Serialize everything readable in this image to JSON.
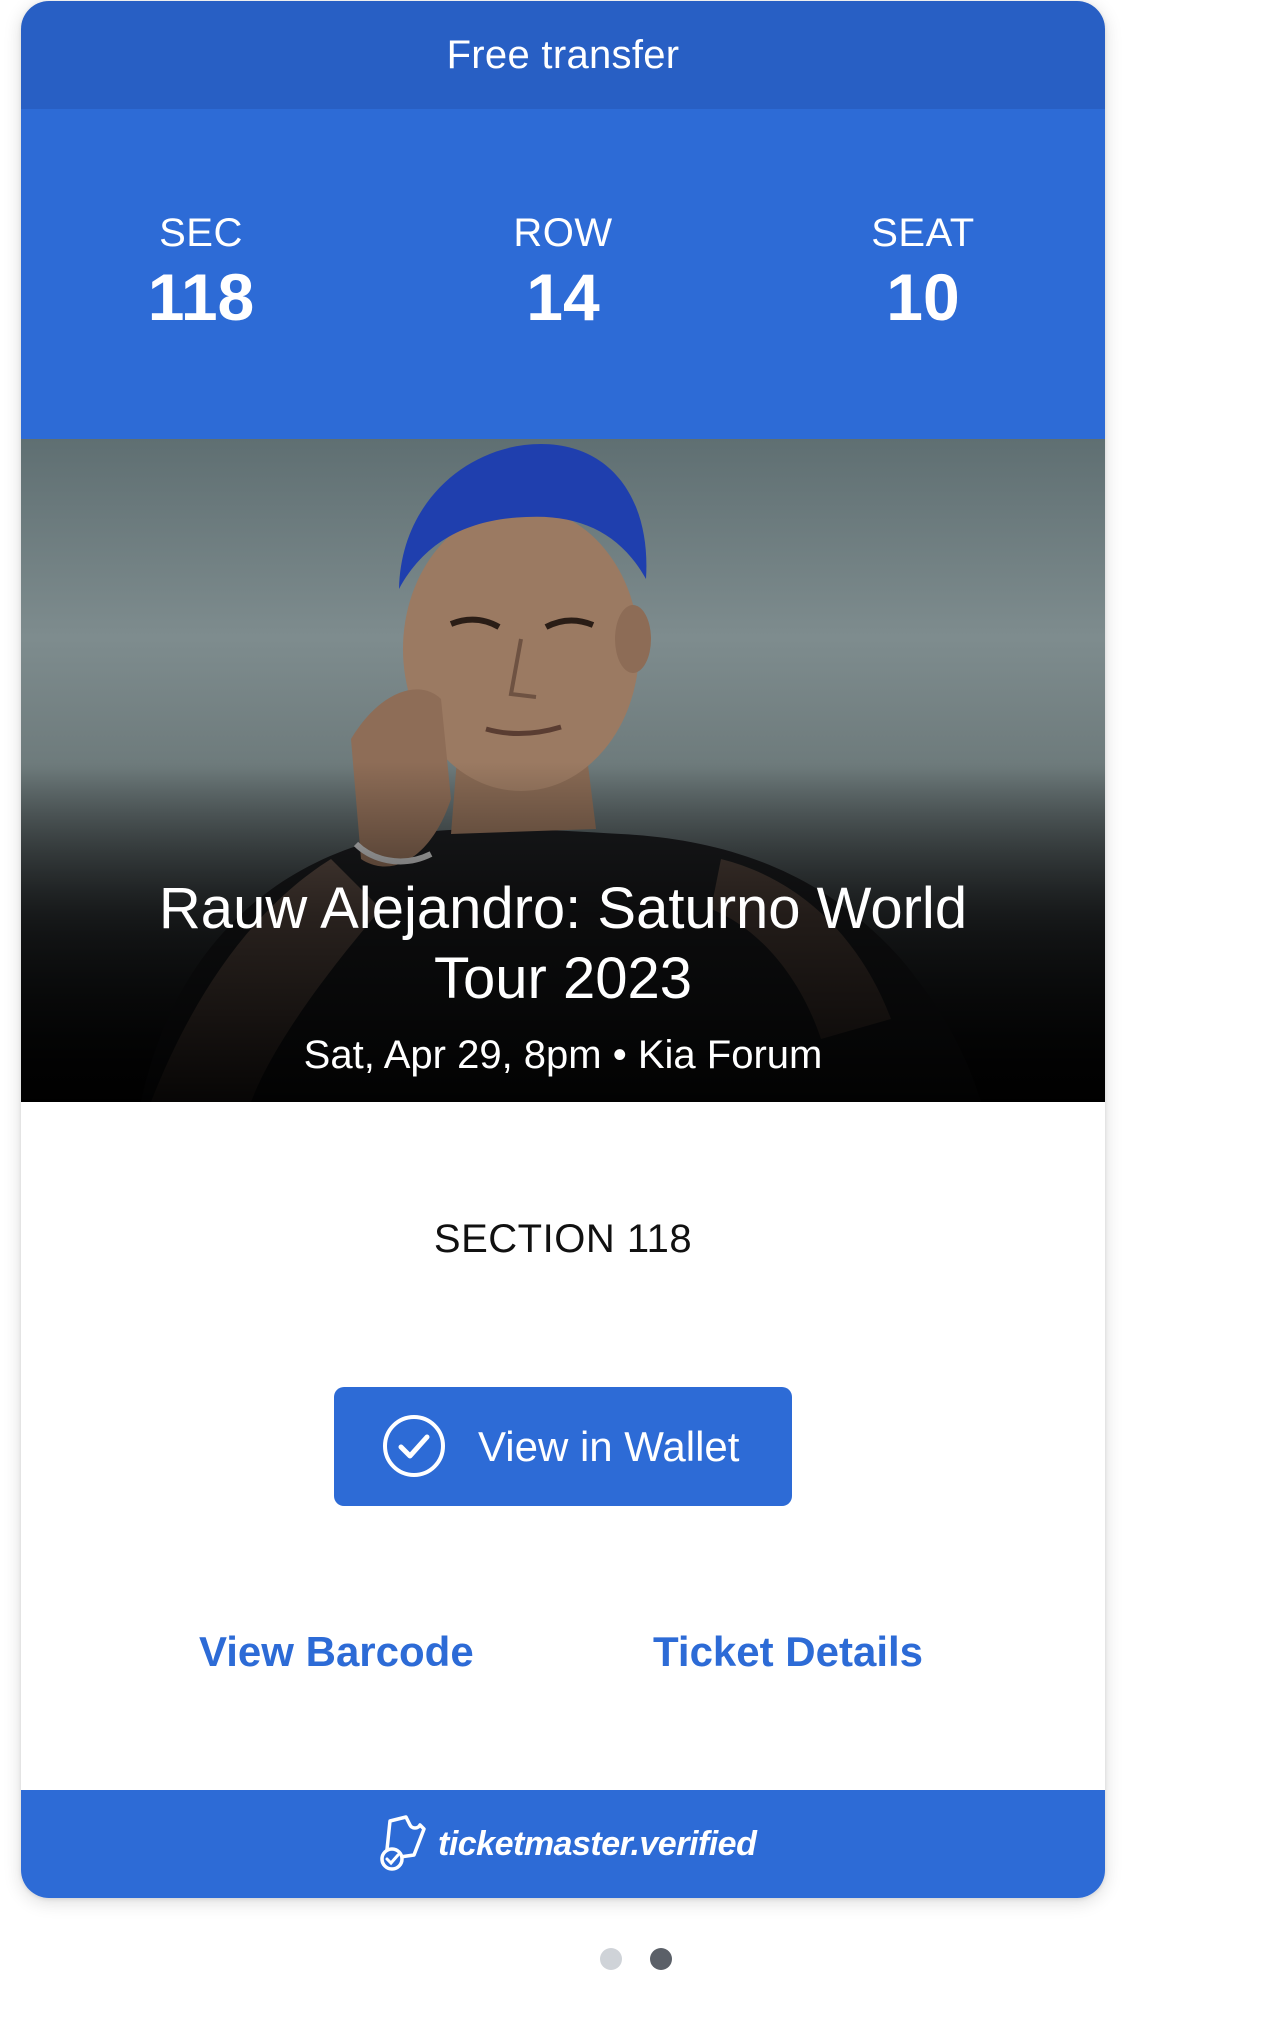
{
  "transfer": {
    "label": "Free transfer"
  },
  "seat": {
    "sec_label": "SEC",
    "sec_value": "118",
    "row_label": "ROW",
    "row_value": "14",
    "seat_label": "SEAT",
    "seat_value": "10"
  },
  "event": {
    "title": "Rauw Alejandro: Saturno World Tour 2023",
    "meta": "Sat, Apr 29, 8pm • Kia Forum",
    "image": "artist-photo"
  },
  "section_label": "SECTION 118",
  "actions": {
    "wallet_label": "View in Wallet",
    "wallet_icon": "check-circle-icon",
    "barcode_label": "View Barcode",
    "details_label": "Ticket Details"
  },
  "footer": {
    "brand_label": "ticketmaster.verified",
    "brand_icon": "verified-ticket-icon"
  },
  "pager": {
    "total": 2,
    "current": 2
  },
  "colors": {
    "header_bar": "#285fc4",
    "brand_blue": "#2d6bd6",
    "dot_inactive": "#cfd3d8",
    "dot_active": "#5b6068"
  }
}
